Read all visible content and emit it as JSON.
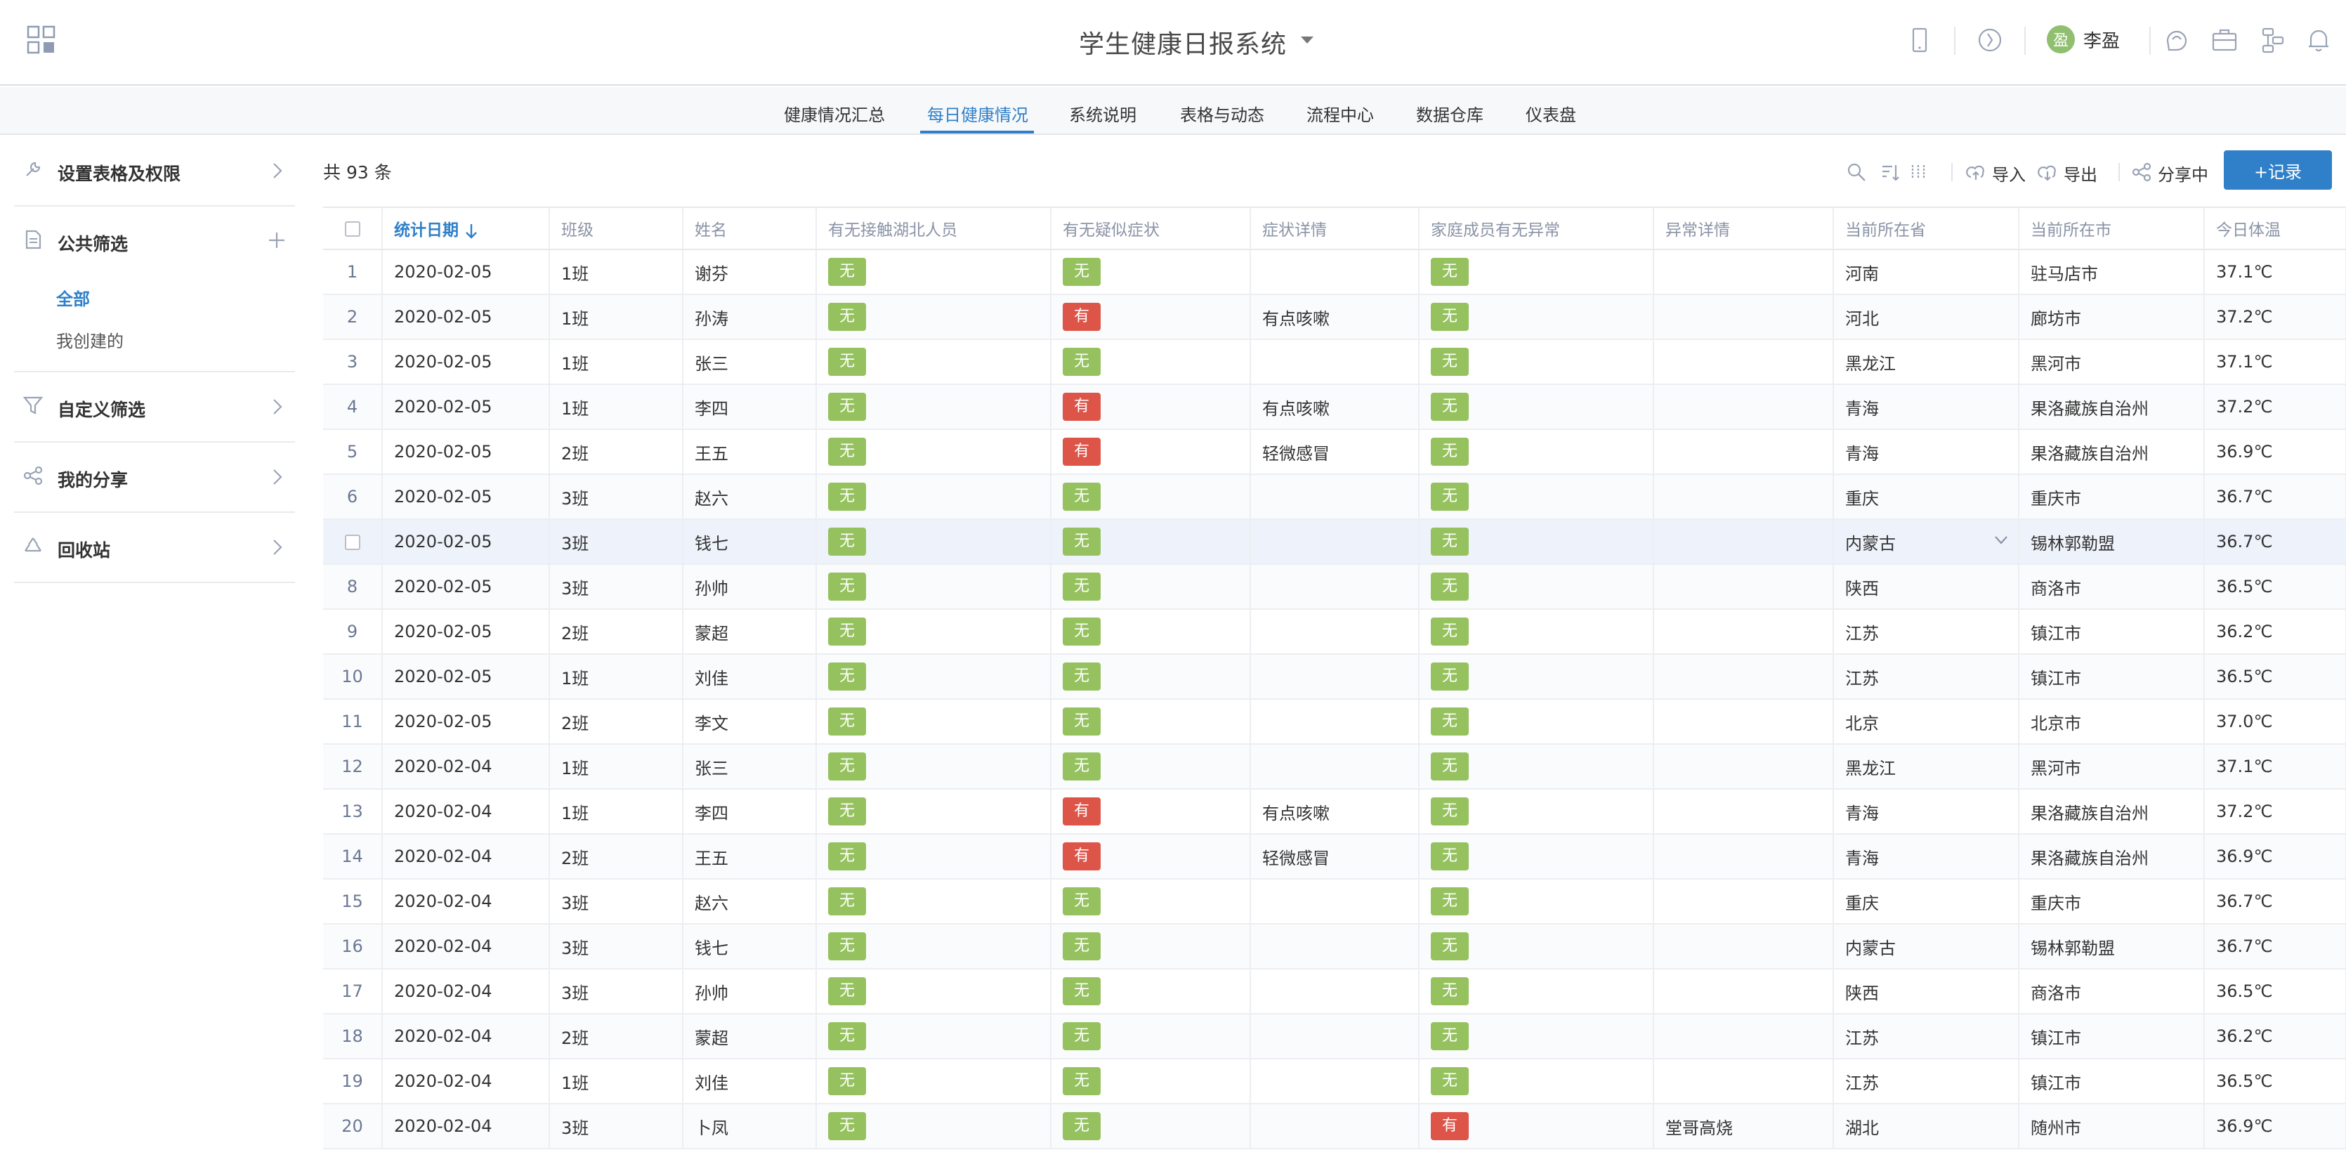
{
  "header": {
    "title": "学生健康日报系统",
    "user_avatar_char": "盈",
    "user_name": "李盈",
    "icons": [
      "apps-grid-icon",
      "mobile-icon",
      "compass-icon",
      "help-bubble-icon",
      "briefcase-icon",
      "workflow-icon",
      "bell-icon"
    ]
  },
  "tabs": [
    {
      "label": "健康情况汇总"
    },
    {
      "label": "每日健康情况",
      "active": true
    },
    {
      "label": "系统说明"
    },
    {
      "label": "表格与动态"
    },
    {
      "label": "流程中心"
    },
    {
      "label": "数据仓库"
    },
    {
      "label": "仪表盘"
    }
  ],
  "sidebar": {
    "settings": "设置表格及权限",
    "public_filter": "公共筛选",
    "public_all": "全部",
    "public_mine": "我创建的",
    "custom_filter": "自定义筛选",
    "my_share": "我的分享",
    "recycle": "回收站"
  },
  "toolbar": {
    "count": "共 93 条",
    "import": "导入",
    "export": "导出",
    "share": "分享中",
    "add_record": "+记录"
  },
  "table": {
    "columns": [
      "统计日期",
      "班级",
      "姓名",
      "有无接触湖北人员",
      "有无疑似症状",
      "症状详情",
      "家庭成员有无异常",
      "异常详情",
      "当前所在省",
      "当前所在市",
      "今日体温"
    ],
    "rows": [
      {
        "no": "1",
        "date": "2020-02-05",
        "cls": "1班",
        "name": "谢芬",
        "contact": "无",
        "symptom": "无",
        "detail": "",
        "family": "无",
        "fdetail": "",
        "prov": "河南",
        "city": "驻马店市",
        "temp": "37.1℃"
      },
      {
        "no": "2",
        "date": "2020-02-05",
        "cls": "1班",
        "name": "孙涛",
        "contact": "无",
        "symptom": "有",
        "detail": "有点咳嗽",
        "family": "无",
        "fdetail": "",
        "prov": "河北",
        "city": "廊坊市",
        "temp": "37.2℃"
      },
      {
        "no": "3",
        "date": "2020-02-05",
        "cls": "1班",
        "name": "张三",
        "contact": "无",
        "symptom": "无",
        "detail": "",
        "family": "无",
        "fdetail": "",
        "prov": "黑龙江",
        "city": "黑河市",
        "temp": "37.1℃"
      },
      {
        "no": "4",
        "date": "2020-02-05",
        "cls": "1班",
        "name": "李四",
        "contact": "无",
        "symptom": "有",
        "detail": "有点咳嗽",
        "family": "无",
        "fdetail": "",
        "prov": "青海",
        "city": "果洛藏族自治州",
        "temp": "37.2℃"
      },
      {
        "no": "5",
        "date": "2020-02-05",
        "cls": "2班",
        "name": "王五",
        "contact": "无",
        "symptom": "有",
        "detail": "轻微感冒",
        "family": "无",
        "fdetail": "",
        "prov": "青海",
        "city": "果洛藏族自治州",
        "temp": "36.9℃"
      },
      {
        "no": "6",
        "date": "2020-02-05",
        "cls": "3班",
        "name": "赵六",
        "contact": "无",
        "symptom": "无",
        "detail": "",
        "family": "无",
        "fdetail": "",
        "prov": "重庆",
        "city": "重庆市",
        "temp": "36.7℃"
      },
      {
        "no": "",
        "date": "2020-02-05",
        "cls": "3班",
        "name": "钱七",
        "contact": "无",
        "symptom": "无",
        "detail": "",
        "family": "无",
        "fdetail": "",
        "prov": "内蒙古",
        "city": "锡林郭勒盟",
        "temp": "36.7℃"
      },
      {
        "no": "8",
        "date": "2020-02-05",
        "cls": "3班",
        "name": "孙帅",
        "contact": "无",
        "symptom": "无",
        "detail": "",
        "family": "无",
        "fdetail": "",
        "prov": "陕西",
        "city": "商洛市",
        "temp": "36.5℃"
      },
      {
        "no": "9",
        "date": "2020-02-05",
        "cls": "2班",
        "name": "蒙超",
        "contact": "无",
        "symptom": "无",
        "detail": "",
        "family": "无",
        "fdetail": "",
        "prov": "江苏",
        "city": "镇江市",
        "temp": "36.2℃"
      },
      {
        "no": "10",
        "date": "2020-02-05",
        "cls": "1班",
        "name": "刘佳",
        "contact": "无",
        "symptom": "无",
        "detail": "",
        "family": "无",
        "fdetail": "",
        "prov": "江苏",
        "city": "镇江市",
        "temp": "36.5℃"
      },
      {
        "no": "11",
        "date": "2020-02-05",
        "cls": "2班",
        "name": "李文",
        "contact": "无",
        "symptom": "无",
        "detail": "",
        "family": "无",
        "fdetail": "",
        "prov": "北京",
        "city": "北京市",
        "temp": "37.0℃"
      },
      {
        "no": "12",
        "date": "2020-02-04",
        "cls": "1班",
        "name": "张三",
        "contact": "无",
        "symptom": "无",
        "detail": "",
        "family": "无",
        "fdetail": "",
        "prov": "黑龙江",
        "city": "黑河市",
        "temp": "37.1℃"
      },
      {
        "no": "13",
        "date": "2020-02-04",
        "cls": "1班",
        "name": "李四",
        "contact": "无",
        "symptom": "有",
        "detail": "有点咳嗽",
        "family": "无",
        "fdetail": "",
        "prov": "青海",
        "city": "果洛藏族自治州",
        "temp": "37.2℃"
      },
      {
        "no": "14",
        "date": "2020-02-04",
        "cls": "2班",
        "name": "王五",
        "contact": "无",
        "symptom": "有",
        "detail": "轻微感冒",
        "family": "无",
        "fdetail": "",
        "prov": "青海",
        "city": "果洛藏族自治州",
        "temp": "36.9℃"
      },
      {
        "no": "15",
        "date": "2020-02-04",
        "cls": "3班",
        "name": "赵六",
        "contact": "无",
        "symptom": "无",
        "detail": "",
        "family": "无",
        "fdetail": "",
        "prov": "重庆",
        "city": "重庆市",
        "temp": "36.7℃"
      },
      {
        "no": "16",
        "date": "2020-02-04",
        "cls": "3班",
        "name": "钱七",
        "contact": "无",
        "symptom": "无",
        "detail": "",
        "family": "无",
        "fdetail": "",
        "prov": "内蒙古",
        "city": "锡林郭勒盟",
        "temp": "36.7℃"
      },
      {
        "no": "17",
        "date": "2020-02-04",
        "cls": "3班",
        "name": "孙帅",
        "contact": "无",
        "symptom": "无",
        "detail": "",
        "family": "无",
        "fdetail": "",
        "prov": "陕西",
        "city": "商洛市",
        "temp": "36.5℃"
      },
      {
        "no": "18",
        "date": "2020-02-04",
        "cls": "2班",
        "name": "蒙超",
        "contact": "无",
        "symptom": "无",
        "detail": "",
        "family": "无",
        "fdetail": "",
        "prov": "江苏",
        "city": "镇江市",
        "temp": "36.2℃"
      },
      {
        "no": "19",
        "date": "2020-02-04",
        "cls": "1班",
        "name": "刘佳",
        "contact": "无",
        "symptom": "无",
        "detail": "",
        "family": "无",
        "fdetail": "",
        "prov": "江苏",
        "city": "镇江市",
        "temp": "36.5℃"
      },
      {
        "no": "20",
        "date": "2020-02-04",
        "cls": "3班",
        "name": "卜凤",
        "contact": "无",
        "symptom": "无",
        "detail": "",
        "family": "有",
        "fdetail": "堂哥高烧",
        "prov": "湖北",
        "city": "随州市",
        "temp": "36.9℃"
      }
    ]
  },
  "colors": {
    "accent": "#2f80c9",
    "tag_none": "#95c25f",
    "tag_yes": "#dd5549"
  }
}
